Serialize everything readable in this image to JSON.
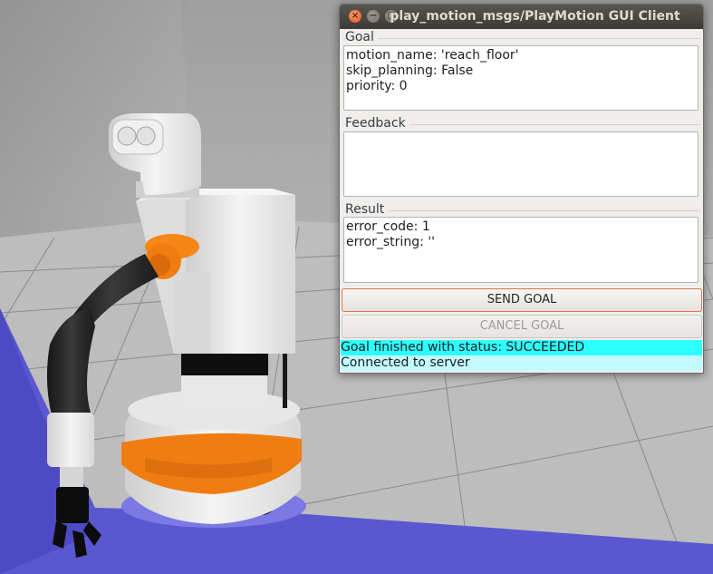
{
  "window": {
    "title": "play_motion_msgs/PlayMotion GUI Client",
    "close_glyph": "×",
    "min_glyph": "−",
    "max_glyph": "□"
  },
  "goal": {
    "label": "Goal",
    "lines": [
      "motion_name: 'reach_floor'",
      "skip_planning: False",
      "priority: 0"
    ]
  },
  "feedback": {
    "label": "Feedback",
    "lines": []
  },
  "result": {
    "label": "Result",
    "lines": [
      "error_code: 1",
      "error_string: ''"
    ]
  },
  "buttons": {
    "send_goal": "SEND GOAL",
    "cancel_goal": "CANCEL GOAL"
  },
  "status": {
    "goal_status": "Goal finished with status: SUCCEEDED",
    "connection": "Connected to server"
  },
  "colors": {
    "status_highlight": "#2effff",
    "status_connected": "#c2fbff",
    "send_border": "#e5714a",
    "robot_accent": "#f07d12",
    "floor_zone": "#5a58d0"
  },
  "icons": [
    "close-icon",
    "minimize-icon",
    "maximize-icon"
  ]
}
